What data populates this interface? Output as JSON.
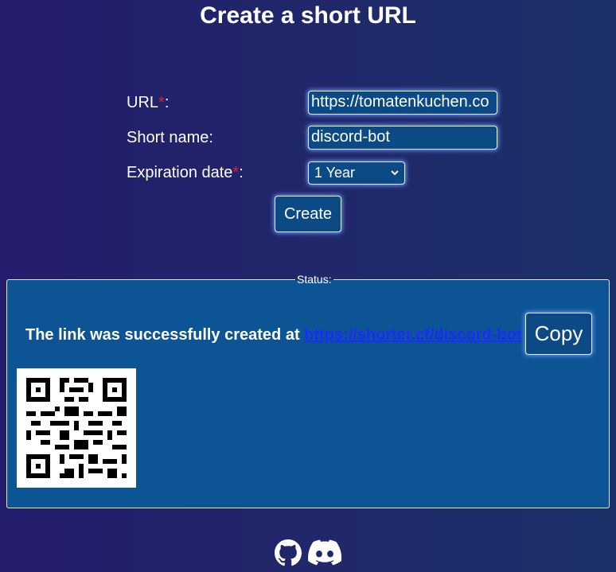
{
  "page": {
    "title": "Create a short URL"
  },
  "form": {
    "url_label": "URL",
    "url_required": "*",
    "url_suffix": ":",
    "url_value": "https://tomatenkuchen.co",
    "short_name_label": "Short name:",
    "short_name_value": "discord-bot",
    "expiration_label": "Expiration date",
    "expiration_required": "*",
    "expiration_suffix": ":",
    "expiration_value": "1 Year",
    "create_label": "Create"
  },
  "status": {
    "legend": "Status:",
    "message": "The link was successfully created at ",
    "link": "https://shorter.cf/discord-bot",
    "copy_label": "Copy"
  },
  "footer": {
    "icons": [
      "github-icon",
      "discord-icon"
    ]
  },
  "colors": {
    "accent": "#0c4a85",
    "status_bg": "#0d5494",
    "link": "#1a2cff",
    "required": "#e0202a"
  }
}
